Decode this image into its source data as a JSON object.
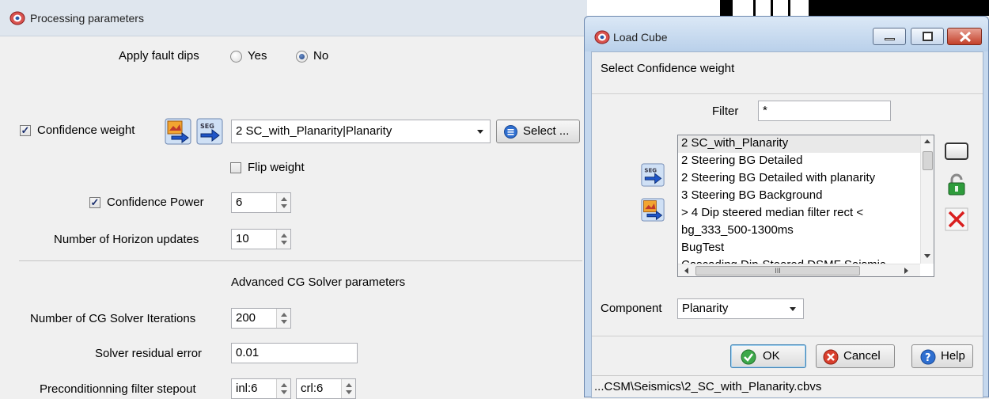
{
  "main": {
    "title": "Processing parameters",
    "apply_fault_dips": {
      "label": "Apply fault dips",
      "yes": "Yes",
      "no": "No",
      "selected": "No"
    },
    "confidence_weight": {
      "label": "Confidence weight",
      "checked": true,
      "value": "2 SC_with_Planarity|Planarity",
      "select_label": "Select ..."
    },
    "flip_weight": {
      "label": "Flip weight",
      "checked": false
    },
    "confidence_power": {
      "label": "Confidence Power",
      "checked": true,
      "value": "6"
    },
    "horizon_updates": {
      "label": "Number of Horizon updates",
      "value": "10"
    },
    "advanced_header": "Advanced CG Solver parameters",
    "cg_iterations": {
      "label": "Number of CG Solver Iterations",
      "value": "200"
    },
    "residual": {
      "label": "Solver residual error",
      "value": "0.01"
    },
    "stepout": {
      "label": "Preconditionning filter stepout",
      "inl": "inl:6",
      "crl": "crl:6"
    }
  },
  "dialog": {
    "title": "Load Cube",
    "heading": "Select Confidence weight",
    "filter": {
      "label": "Filter",
      "value": "*"
    },
    "items": [
      "2 SC_with_Planarity",
      "2 Steering BG Detailed",
      "2 Steering BG Detailed with planarity",
      "3 Steering BG Background",
      "> 4 Dip steered median filter rect <",
      "bg_333_500-1300ms",
      "BugTest",
      "Cascading Dip-Steered DSMF Seismic"
    ],
    "selected_index": 0,
    "hscroll_thumb": "III",
    "component": {
      "label": "Component",
      "value": "Planarity"
    },
    "buttons": {
      "ok": "OK",
      "cancel": "Cancel",
      "help": "Help"
    },
    "status": "...CSM\\Seismics\\2_SC_with_Planarity.cbvs",
    "icons": [
      "segy-import-icon",
      "image-import-icon",
      "rectangle-icon",
      "lock-icon",
      "delete-icon"
    ]
  }
}
